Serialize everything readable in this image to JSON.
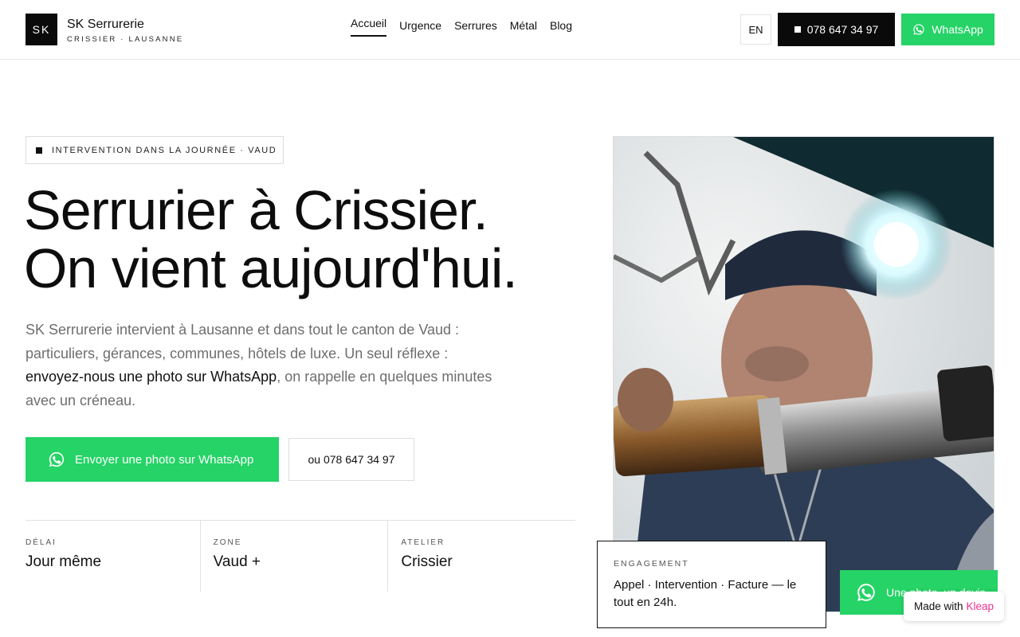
{
  "brand": {
    "logo_text": "SK",
    "name": "SK Serrurerie",
    "subtitle": "CRISSIER · LAUSANNE"
  },
  "nav": {
    "items": [
      {
        "label": "Accueil",
        "active": true
      },
      {
        "label": "Urgence"
      },
      {
        "label": "Serrures"
      },
      {
        "label": "Métal"
      },
      {
        "label": "Blog"
      }
    ]
  },
  "header": {
    "lang": "EN",
    "phone": "078 647 34 97",
    "whatsapp": "WhatsApp"
  },
  "hero": {
    "badge": "INTERVENTION DANS LA JOURNÉE · VAUD",
    "title_line1": "Serrurier à Crissier.",
    "title_line2": "On vient aujourd'hui.",
    "desc_before": "SK Serrurerie intervient à Lausanne et dans tout le canton de Vaud : particuliers, gérances, communes, hôtels de luxe. Un seul réflexe : ",
    "desc_highlight": "envoyez-nous une photo sur WhatsApp",
    "desc_after": ", on rappelle en quelques minutes avec un créneau.",
    "cta_whatsapp": "Envoyer une photo sur WhatsApp",
    "cta_phone": "ou 078 647 34 97"
  },
  "stats": [
    {
      "label": "DÉLAI",
      "value": "Jour même"
    },
    {
      "label": "ZONE",
      "value": "Vaud +"
    },
    {
      "label": "ATELIER",
      "value": "Crissier"
    }
  ],
  "engagement": {
    "label": "ENGAGEMENT",
    "text": "Appel · Intervention · Facture — le tout en 24h."
  },
  "float_whatsapp": "Une photo, un devis",
  "made_with": {
    "prefix": "Made with",
    "brand": "Kleap"
  },
  "colors": {
    "whatsapp_green": "#25d366",
    "black": "#0a0a0a",
    "kleap_pink": "#e9318f"
  },
  "icons": {
    "whatsapp": "whatsapp-icon",
    "square": "square-bullet-icon"
  }
}
